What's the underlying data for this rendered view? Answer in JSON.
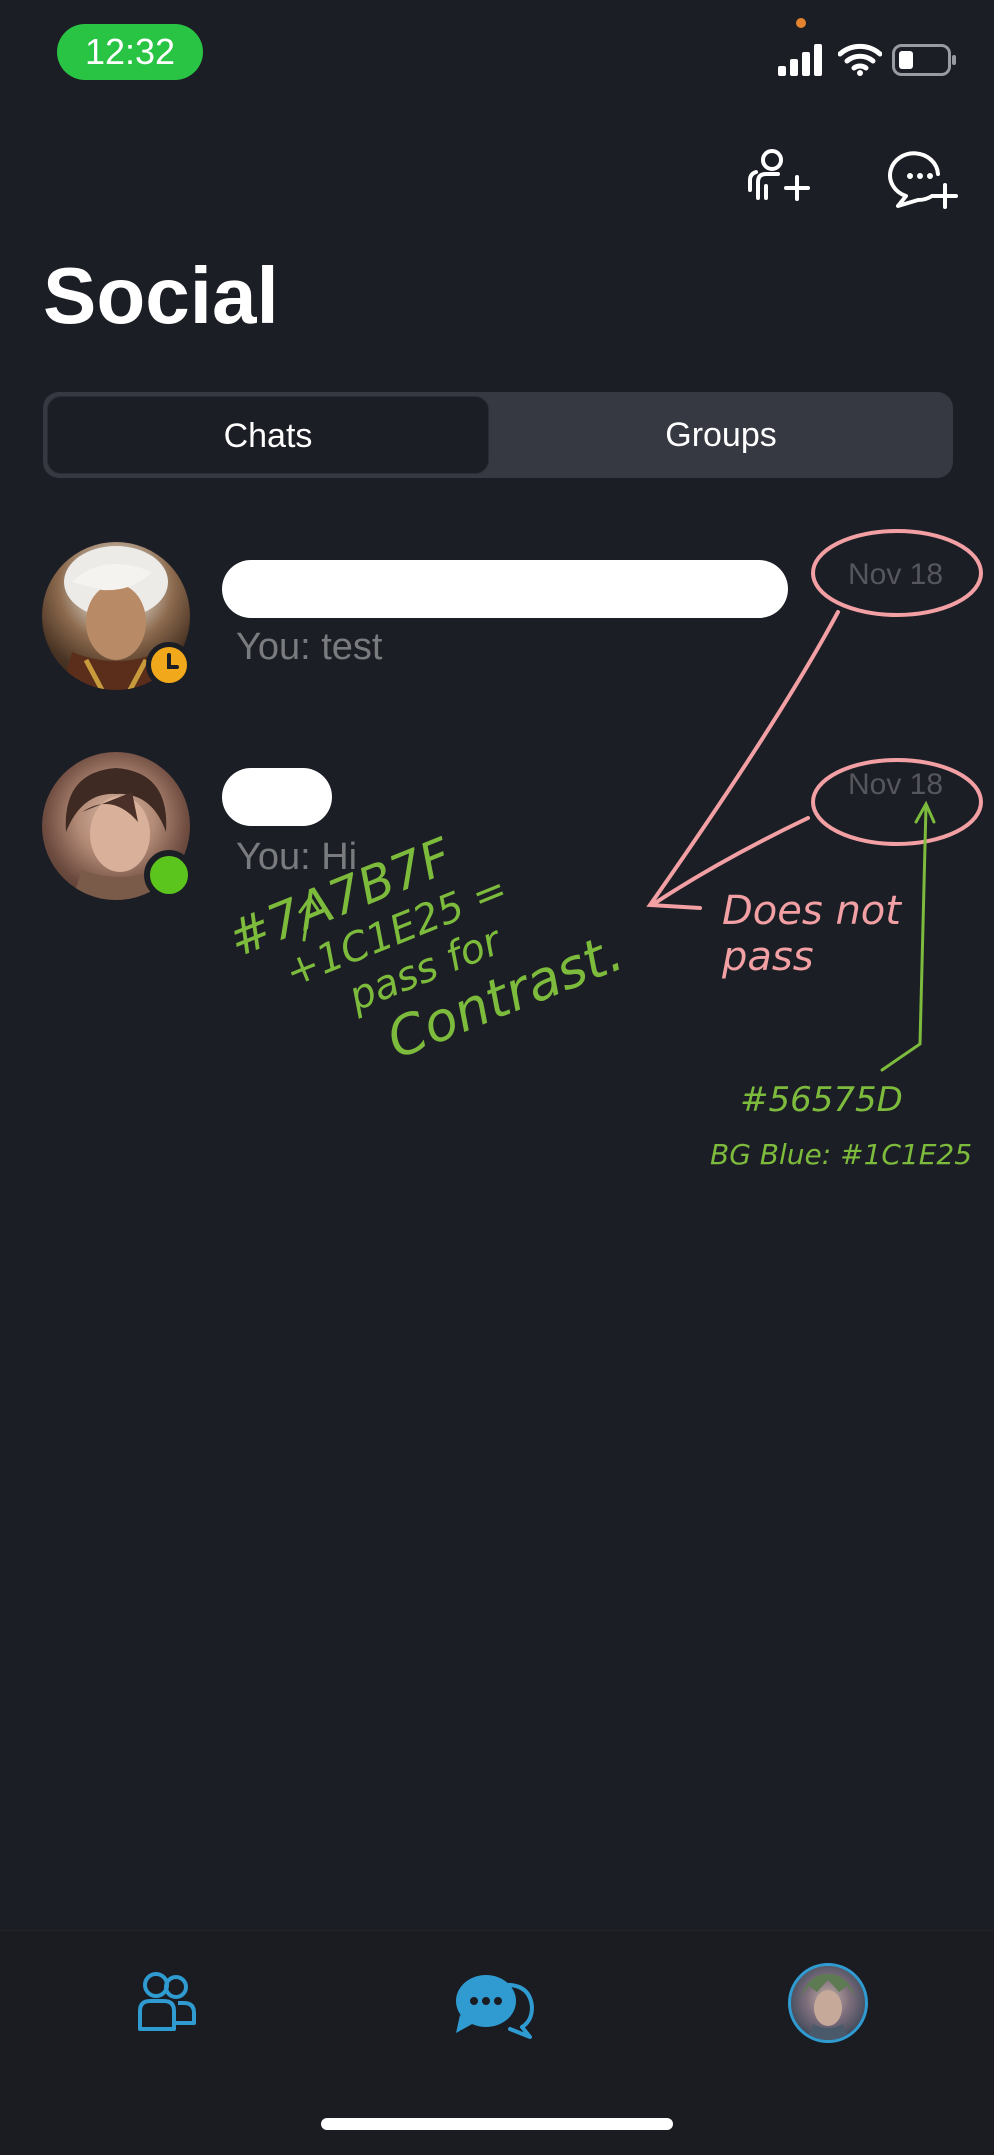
{
  "status_bar": {
    "time": "12:32",
    "icons": [
      "signal-icon",
      "wifi-icon",
      "battery-icon"
    ]
  },
  "header": {
    "icons": [
      "add-friend-icon",
      "new-chat-icon"
    ],
    "title": "Social"
  },
  "tabs": {
    "items": [
      {
        "label": "Chats",
        "active": true
      },
      {
        "label": "Groups",
        "active": false
      }
    ]
  },
  "chats": [
    {
      "preview": "You: test",
      "date": "Nov 18",
      "status": "away"
    },
    {
      "preview": "You: Hi",
      "date": "Nov 18",
      "status": "online"
    }
  ],
  "annotations": {
    "left_note": [
      "#7A7B7F",
      "+1C1E25 =",
      "pass for",
      "Contrast."
    ],
    "right_note": [
      "Does not",
      "pass"
    ],
    "hex_note": "#56575D",
    "bg_note": "BG Blue: #1C1E25"
  },
  "colors": {
    "background": "#1C1E25",
    "preview_text": "#7A7B7F",
    "date_text": "#56575D",
    "online": "#5BC51E",
    "away": "#F1A91B",
    "accent": "#2F9BD1",
    "time_pill": "#29C443"
  },
  "bottom_nav": {
    "items": [
      "friends-icon",
      "chats-icon",
      "profile-avatar"
    ]
  }
}
